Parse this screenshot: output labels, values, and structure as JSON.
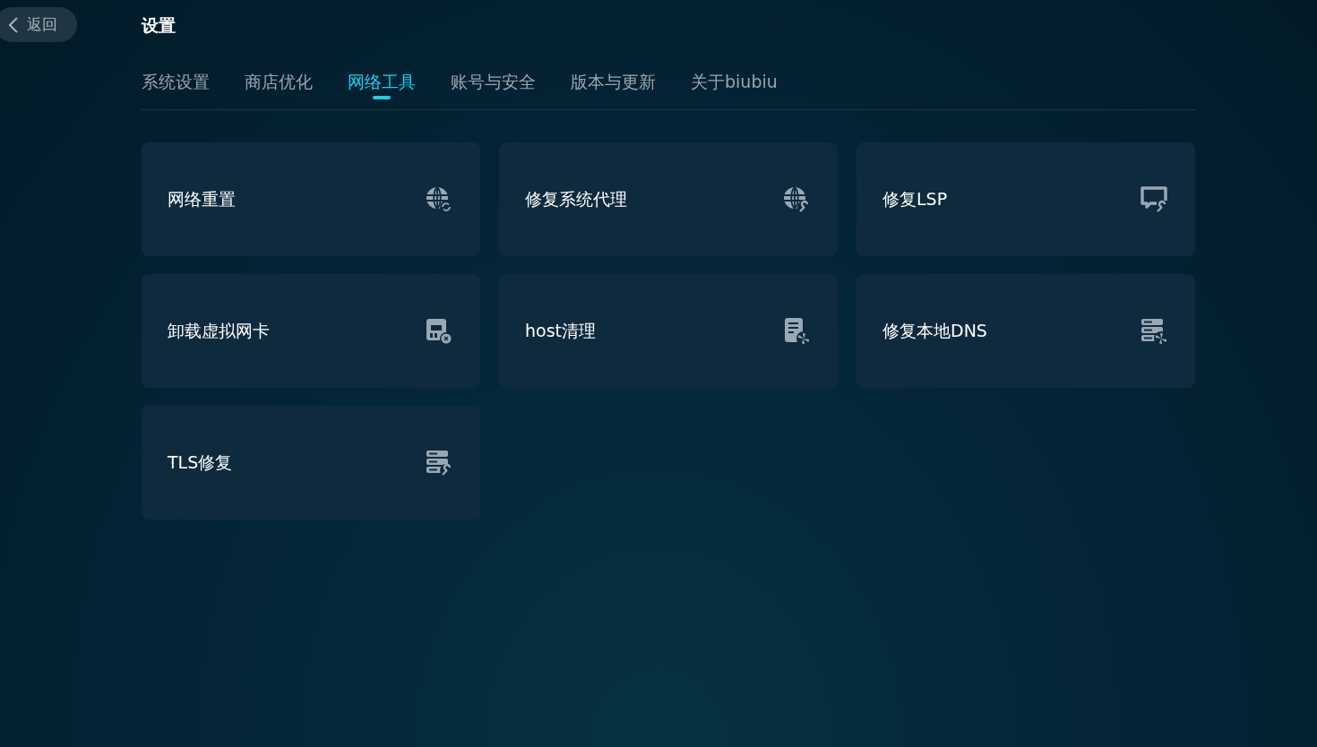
{
  "back_button": {
    "label": "返回"
  },
  "title": "设置",
  "tabs": [
    {
      "label": "系统设置",
      "selected": false
    },
    {
      "label": "商店优化",
      "selected": false
    },
    {
      "label": "网络工具",
      "selected": true
    },
    {
      "label": "账号与安全",
      "selected": false
    },
    {
      "label": "版本与更新",
      "selected": false
    },
    {
      "label": "关于biubiu",
      "selected": false
    }
  ],
  "tools": [
    {
      "label": "网络重置"
    },
    {
      "label": "修复系统代理"
    },
    {
      "label": "修复LSP"
    },
    {
      "label": "卸载虚拟网卡"
    },
    {
      "label": "host清理"
    },
    {
      "label": "修复本地DNS"
    },
    {
      "label": "TLS修复"
    }
  ]
}
